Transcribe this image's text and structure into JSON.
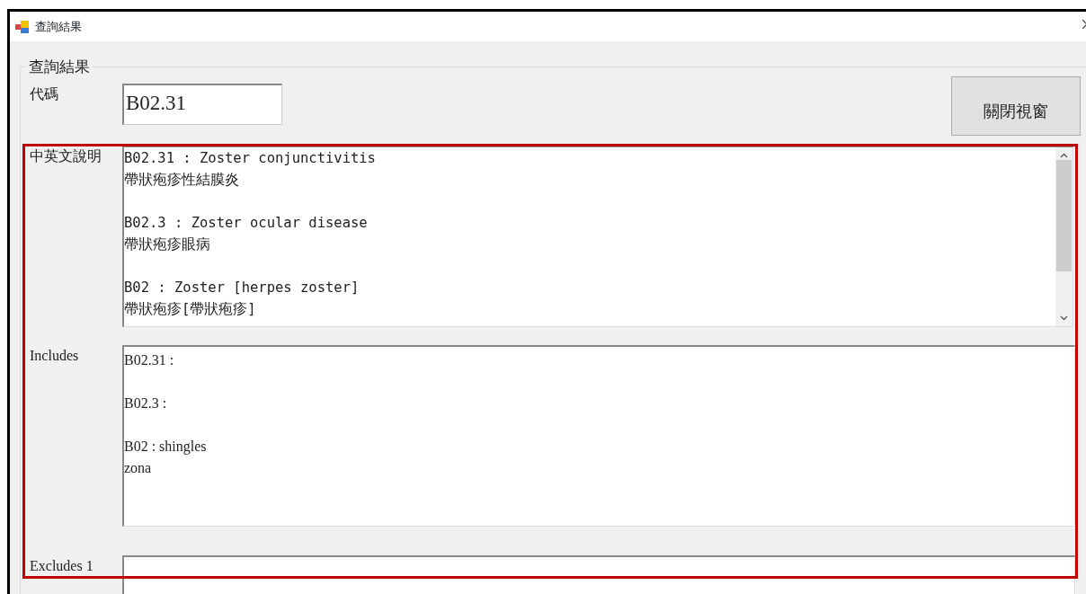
{
  "window": {
    "title": "查詢結果"
  },
  "group": {
    "title": "查詢結果"
  },
  "code": {
    "label": "代碼",
    "value": "B02.31"
  },
  "close_button": {
    "label": "關閉視窗"
  },
  "description": {
    "label": "中英文說明",
    "entries": [
      {
        "lines": [
          "B02.31 : Zoster conjunctivitis",
          "帶狀疱疹性結膜炎"
        ]
      },
      {
        "lines": [
          "B02.3 : Zoster ocular disease",
          "帶狀疱疹眼病"
        ]
      },
      {
        "lines": [
          "B02 : Zoster [herpes zoster]",
          "帶狀疱疹[帶狀疱疹]"
        ]
      }
    ]
  },
  "includes": {
    "label": "Includes",
    "entries": [
      {
        "lines": [
          "B02.31 :"
        ]
      },
      {
        "lines": [
          "B02.3 :"
        ]
      },
      {
        "lines": [
          "B02 : shingles",
          "zona"
        ]
      }
    ]
  },
  "excludes_1": {
    "label": "Excludes 1"
  }
}
